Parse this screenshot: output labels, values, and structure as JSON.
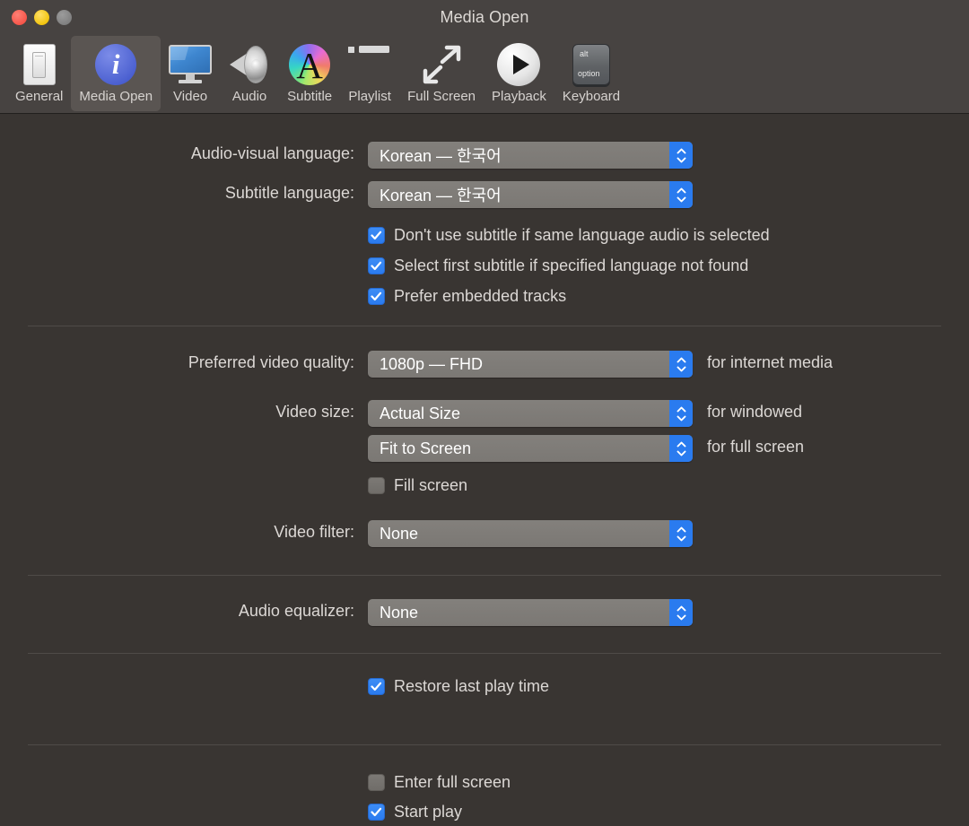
{
  "window": {
    "title": "Media Open",
    "traffic_lights": [
      "close",
      "minimize",
      "zoom"
    ]
  },
  "toolbar": {
    "items": [
      {
        "label": "General",
        "icon": "switch-icon",
        "selected": false
      },
      {
        "label": "Media Open",
        "icon": "info-circle-icon",
        "selected": true
      },
      {
        "label": "Video",
        "icon": "monitor-icon",
        "selected": false
      },
      {
        "label": "Audio",
        "icon": "speaker-icon",
        "selected": false
      },
      {
        "label": "Subtitle",
        "icon": "color-wheel-a-icon",
        "selected": false
      },
      {
        "label": "Playlist",
        "icon": "list-icon",
        "selected": false
      },
      {
        "label": "Full Screen",
        "icon": "expand-arrows-icon",
        "selected": false
      },
      {
        "label": "Playback",
        "icon": "play-circle-icon",
        "selected": false
      },
      {
        "label": "Keyboard",
        "icon": "option-key-icon",
        "selected": false
      }
    ]
  },
  "panel": {
    "audio_visual_language": {
      "label": "Audio-visual language:",
      "value": "Korean — 한국어"
    },
    "subtitle_language": {
      "label": "Subtitle language:",
      "value": "Korean — 한국어"
    },
    "subtitle_options": [
      {
        "label": "Don't use subtitle if same language audio is selected",
        "checked": true
      },
      {
        "label": "Select first subtitle if specified language not found",
        "checked": true
      },
      {
        "label": "Prefer embedded tracks",
        "checked": true
      }
    ],
    "preferred_video_quality": {
      "label": "Preferred video quality:",
      "value": "1080p — FHD",
      "suffix": "for internet media"
    },
    "video_size": {
      "label": "Video size:",
      "windowed_value": "Actual Size",
      "windowed_suffix": "for windowed",
      "fullscreen_value": "Fit to Screen",
      "fullscreen_suffix": "for full screen"
    },
    "fill_screen": {
      "label": "Fill screen",
      "checked": false
    },
    "video_filter": {
      "label": "Video filter:",
      "value": "None"
    },
    "audio_equalizer": {
      "label": "Audio equalizer:",
      "value": "None"
    },
    "restore_last_play_time": {
      "label": "Restore last play time",
      "checked": true
    },
    "enter_full_screen": {
      "label": "Enter full screen",
      "checked": false
    },
    "start_play": {
      "label": "Start play",
      "checked": true
    }
  },
  "colors": {
    "window_bg": "#393532",
    "toolbar_bg": "#474341",
    "accent_blue": "#2a7bef",
    "text": "#dcd8d5",
    "popup_bg": "#7f7c78"
  }
}
